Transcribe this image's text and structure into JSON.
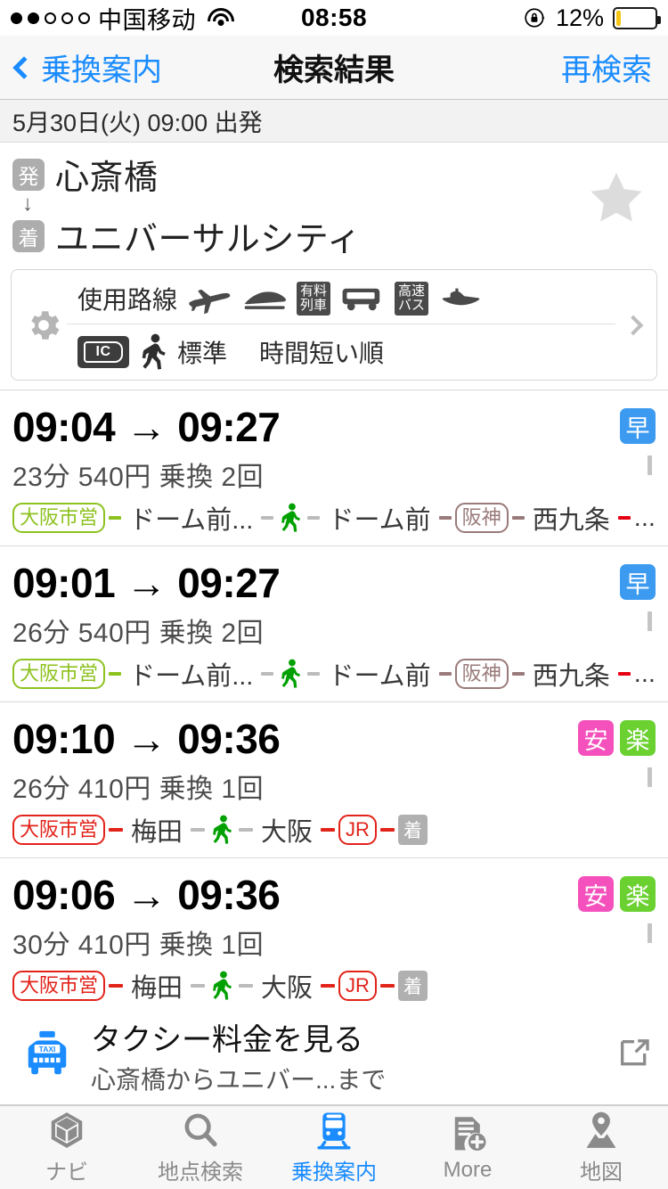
{
  "status_bar": {
    "signal_filled": 2,
    "signal_total": 5,
    "carrier": "中国移动",
    "wifi_icon": "wifi-icon",
    "time": "08:58",
    "rotation_lock_icon": "rotation-lock-icon",
    "battery_percent": "12%",
    "battery_level": 12,
    "battery_color": "#f5c518"
  },
  "nav": {
    "back_icon": "chevron-left-icon",
    "back_label": "乗換案内",
    "title": "検索結果",
    "right_action": "再検索",
    "accent_color": "#1a8cff"
  },
  "date_bar": {
    "text": "5月30日(火) 09:00 出発"
  },
  "route_header": {
    "origin_badge": "発",
    "origin": "心斎橋",
    "arrow": "↓",
    "destination_badge": "着",
    "destination": "ユニバーサルシティ",
    "favorite_icon": "star-icon",
    "favorite_active": false
  },
  "conditions": {
    "gear_icon": "gear-icon",
    "lines_label": "使用路線",
    "transport_icons": [
      {
        "name": "airplane-icon",
        "label": ""
      },
      {
        "name": "shinkansen-icon",
        "label": ""
      },
      {
        "name": "limited-express-icon",
        "label": "有料\n列車"
      },
      {
        "name": "bus-icon",
        "label": ""
      },
      {
        "name": "highway-bus-icon",
        "label": "高速\nバス"
      },
      {
        "name": "ferry-icon",
        "label": ""
      }
    ],
    "ic_badge": "IC",
    "walk_icon": "walking-person-icon",
    "walk_speed": "標準",
    "sort_order": "時間短い順",
    "chevron_icon": "chevron-right-icon"
  },
  "routes": [
    {
      "depart": "09:04",
      "arrow": "→",
      "arrive": "09:27",
      "badges": [
        {
          "label": "早",
          "kind": "haya",
          "color": "#3c9bf0"
        }
      ],
      "duration": "23分",
      "fare": "540円",
      "transfers": "乗換 2回",
      "summary": "23分  540円  乗換 2回",
      "segments": [
        {
          "type": "line-badge",
          "label": "大阪市営",
          "color": "#8dc21f"
        },
        {
          "type": "dash",
          "color": "#8dc21f"
        },
        {
          "type": "station",
          "label": "ドーム前..."
        },
        {
          "type": "dash",
          "color": "#bbbbbb"
        },
        {
          "type": "walk",
          "label": "walking-person-icon",
          "color": "#00a000"
        },
        {
          "type": "dash",
          "color": "#bbbbbb"
        },
        {
          "type": "station",
          "label": "ドーム前"
        },
        {
          "type": "dash",
          "color": "#9a7a7a"
        },
        {
          "type": "line-badge",
          "label": "阪神",
          "color": "#9a7a7a"
        },
        {
          "type": "dash",
          "color": "#9a7a7a"
        },
        {
          "type": "station",
          "label": "西九条"
        },
        {
          "type": "dash",
          "color": "#e60012"
        },
        {
          "type": "ellipsis",
          "label": "..."
        }
      ]
    },
    {
      "depart": "09:01",
      "arrow": "→",
      "arrive": "09:27",
      "badges": [
        {
          "label": "早",
          "kind": "haya",
          "color": "#3c9bf0"
        }
      ],
      "duration": "26分",
      "fare": "540円",
      "transfers": "乗換 2回",
      "summary": "26分  540円  乗換 2回",
      "segments": [
        {
          "type": "line-badge",
          "label": "大阪市営",
          "color": "#8dc21f"
        },
        {
          "type": "dash",
          "color": "#8dc21f"
        },
        {
          "type": "station",
          "label": "ドーム前..."
        },
        {
          "type": "dash",
          "color": "#bbbbbb"
        },
        {
          "type": "walk",
          "label": "walking-person-icon",
          "color": "#00a000"
        },
        {
          "type": "dash",
          "color": "#bbbbbb"
        },
        {
          "type": "station",
          "label": "ドーム前"
        },
        {
          "type": "dash",
          "color": "#9a7a7a"
        },
        {
          "type": "line-badge",
          "label": "阪神",
          "color": "#9a7a7a"
        },
        {
          "type": "dash",
          "color": "#9a7a7a"
        },
        {
          "type": "station",
          "label": "西九条"
        },
        {
          "type": "dash",
          "color": "#e60012"
        },
        {
          "type": "ellipsis",
          "label": "..."
        }
      ]
    },
    {
      "depart": "09:10",
      "arrow": "→",
      "arrive": "09:36",
      "badges": [
        {
          "label": "安",
          "kind": "yasu",
          "color": "#f451bd"
        },
        {
          "label": "楽",
          "kind": "raku",
          "color": "#6bd131"
        }
      ],
      "duration": "26分",
      "fare": "410円",
      "transfers": "乗換 1回",
      "summary": "26分  410円  乗換 1回",
      "segments": [
        {
          "type": "line-badge",
          "label": "大阪市営",
          "color": "#e2231a"
        },
        {
          "type": "dash",
          "color": "#e2231a"
        },
        {
          "type": "station",
          "label": "梅田"
        },
        {
          "type": "dash",
          "color": "#bbbbbb"
        },
        {
          "type": "walk",
          "label": "walking-person-icon",
          "color": "#00a000"
        },
        {
          "type": "dash",
          "color": "#bbbbbb"
        },
        {
          "type": "station",
          "label": "大阪"
        },
        {
          "type": "dash",
          "color": "#e2231a"
        },
        {
          "type": "line-badge",
          "label": "JR",
          "color": "#e2231a"
        },
        {
          "type": "dash",
          "color": "#e2231a"
        },
        {
          "type": "arrive-box",
          "label": "着"
        }
      ]
    },
    {
      "depart": "09:06",
      "arrow": "→",
      "arrive": "09:36",
      "badges": [
        {
          "label": "安",
          "kind": "yasu",
          "color": "#f451bd"
        },
        {
          "label": "楽",
          "kind": "raku",
          "color": "#6bd131"
        }
      ],
      "duration": "30分",
      "fare": "410円",
      "transfers": "乗換 1回",
      "summary": "30分  410円  乗換 1回",
      "segments": [
        {
          "type": "line-badge",
          "label": "大阪市営",
          "color": "#e2231a"
        },
        {
          "type": "dash",
          "color": "#e2231a"
        },
        {
          "type": "station",
          "label": "梅田"
        },
        {
          "type": "dash",
          "color": "#bbbbbb"
        },
        {
          "type": "walk",
          "label": "walking-person-icon",
          "color": "#00a000"
        },
        {
          "type": "dash",
          "color": "#bbbbbb"
        },
        {
          "type": "station",
          "label": "大阪"
        },
        {
          "type": "dash",
          "color": "#e2231a"
        },
        {
          "type": "line-badge",
          "label": "JR",
          "color": "#e2231a"
        },
        {
          "type": "dash",
          "color": "#e2231a"
        },
        {
          "type": "arrive-box",
          "label": "着"
        }
      ]
    }
  ],
  "taxi_banner": {
    "icon": "taxi-icon",
    "title": "タクシー料金を見る",
    "subtitle": "心斎橋からユニバー...まで",
    "external_icon": "external-link-icon"
  },
  "tab_bar": {
    "active_index": 2,
    "active_color": "#1a8cff",
    "inactive_color": "#8b8b8b",
    "items": [
      {
        "label": "ナビ",
        "icon": "navigation-cube-icon"
      },
      {
        "label": "地点検索",
        "icon": "search-icon"
      },
      {
        "label": "乗換案内",
        "icon": "train-icon"
      },
      {
        "label": "More",
        "icon": "more-document-icon"
      },
      {
        "label": "地図",
        "icon": "map-pin-icon"
      }
    ]
  }
}
